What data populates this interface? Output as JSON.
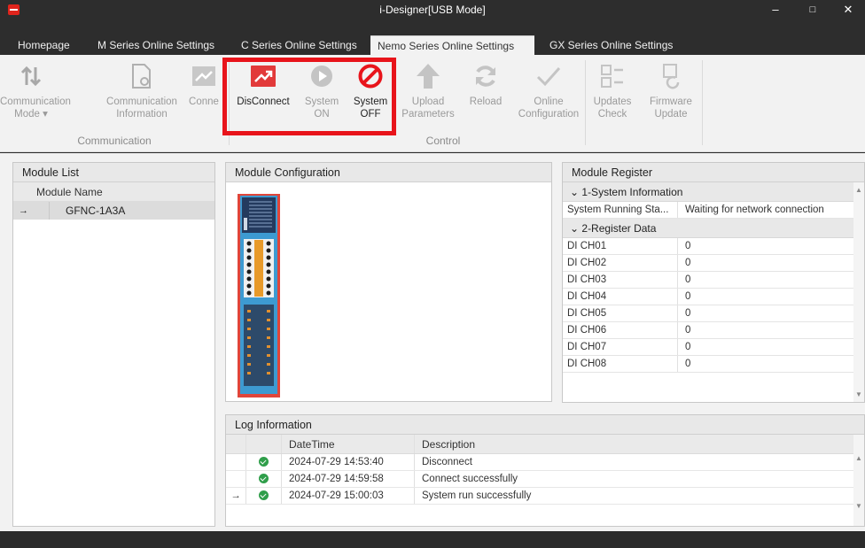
{
  "window": {
    "title": "i-Designer[USB Mode]",
    "minimize": "–",
    "maximize": "□",
    "close": "✕"
  },
  "tabs": [
    {
      "label": "Homepage"
    },
    {
      "label": "M Series Online Settings"
    },
    {
      "label": "C Series Online Settings"
    },
    {
      "label": "Nemo Series Online Settings"
    },
    {
      "label": "GX Series Online Settings"
    }
  ],
  "ribbon": {
    "comm_mode": "Communication",
    "comm_mode2": "Mode ▾",
    "comm_info": "Communication",
    "comm_info2": "Information",
    "connect": "Conne",
    "disconnect": "DisConnect",
    "sys_on": "System",
    "sys_on2": "ON",
    "sys_off": "System",
    "sys_off2": "OFF",
    "upload": "Upload",
    "upload2": "Parameters",
    "reload": "Reload",
    "online": "Online",
    "online2": "Configuration",
    "updates": "Updates",
    "updates2": "Check",
    "firmware": "Firmware",
    "firmware2": "Update",
    "group_comm": "Communication",
    "group_control": "Control"
  },
  "module_list": {
    "title": "Module List",
    "column": "Module Name",
    "rows": [
      {
        "arrow": "→",
        "name": "GFNC-1A3A"
      }
    ]
  },
  "module_config": {
    "title": "Module Configuration"
  },
  "register": {
    "title": "Module Register",
    "section1": "⌄ 1-System Information",
    "sys_name": "System Running Sta...",
    "sys_value": "Waiting for network connection",
    "section2": "⌄ 2-Register Data",
    "rows": [
      {
        "name": "DI CH01",
        "value": "0"
      },
      {
        "name": "DI CH02",
        "value": "0"
      },
      {
        "name": "DI CH03",
        "value": "0"
      },
      {
        "name": "DI CH04",
        "value": "0"
      },
      {
        "name": "DI CH05",
        "value": "0"
      },
      {
        "name": "DI CH06",
        "value": "0"
      },
      {
        "name": "DI CH07",
        "value": "0"
      },
      {
        "name": "DI CH08",
        "value": "0"
      }
    ]
  },
  "log": {
    "title": "Log Information",
    "col_datetime": "DateTime",
    "col_desc": "Description",
    "rows": [
      {
        "arrow": "",
        "datetime": "2024-07-29 14:53:40",
        "desc": "Disconnect"
      },
      {
        "arrow": "",
        "datetime": "2024-07-29 14:59:58",
        "desc": "Connect successfully"
      },
      {
        "arrow": "→",
        "datetime": "2024-07-29 15:00:03",
        "desc": "System run successfully"
      }
    ]
  },
  "colors": {
    "accent_red": "#e8141b",
    "ok_green": "#2f9e4a",
    "titlebar": "#2d2d2d"
  }
}
